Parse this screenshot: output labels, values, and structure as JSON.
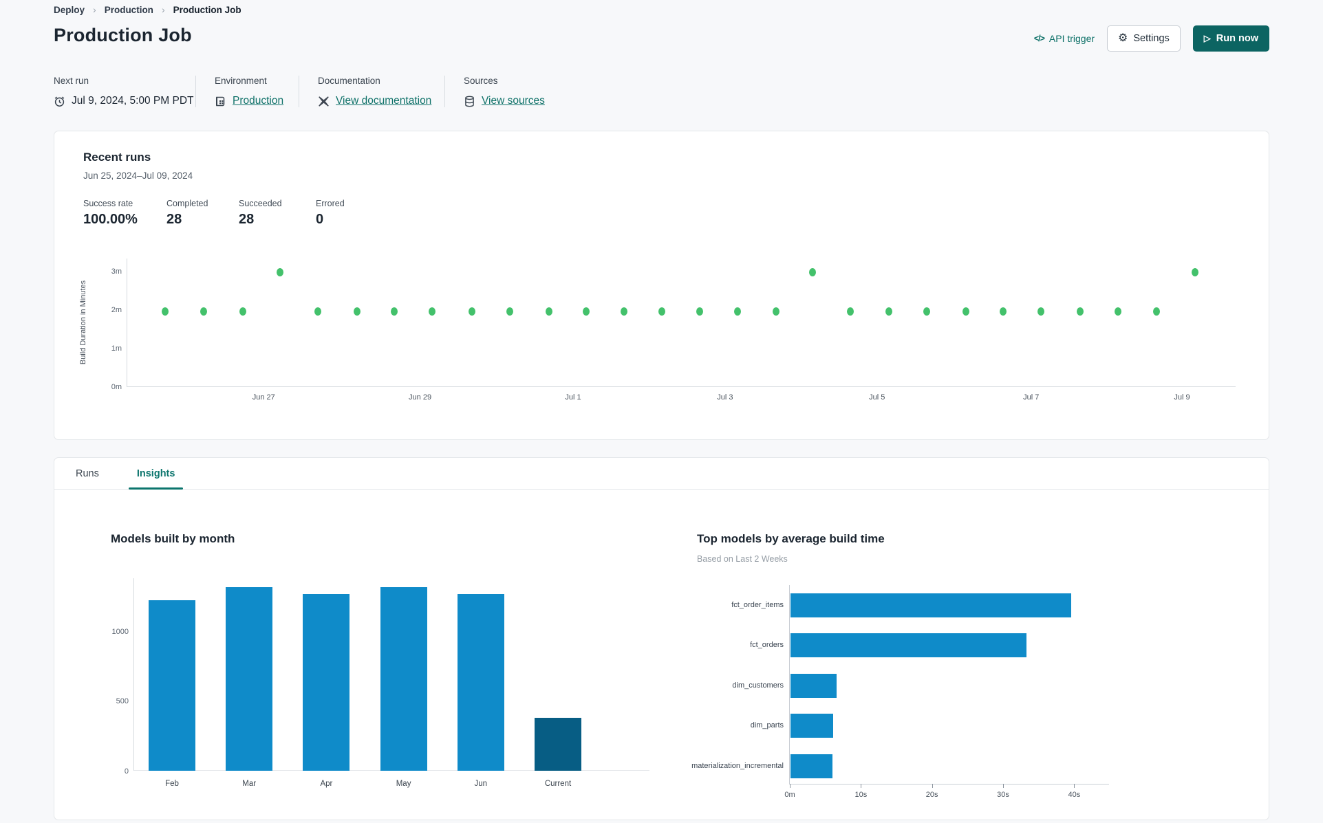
{
  "breadcrumb": {
    "items": [
      "Deploy",
      "Production",
      "Production Job"
    ]
  },
  "header": {
    "title": "Production Job",
    "api_trigger_label": "API trigger",
    "settings_label": "Settings",
    "run_now_label": "Run now"
  },
  "icons": {
    "breadcrumb_sep": "›",
    "code": "</>",
    "gear": "⚙",
    "play": "▷",
    "clock": "alarm-clock",
    "environment": "server-grid",
    "documentation": "dbt-logo",
    "sources": "database-cylinder"
  },
  "info": {
    "next_run": {
      "label": "Next run",
      "value": "Jul 9, 2024, 5:00 PM PDT"
    },
    "environment": {
      "label": "Environment",
      "value": "Production"
    },
    "documentation": {
      "label": "Documentation",
      "value": "View documentation"
    },
    "sources": {
      "label": "Sources",
      "value": "View sources"
    }
  },
  "recent_runs": {
    "title": "Recent runs",
    "date_range": "Jun 25, 2024–Jul 09, 2024",
    "stats": [
      {
        "label": "Success rate",
        "value": "100.00%"
      },
      {
        "label": "Completed",
        "value": "28"
      },
      {
        "label": "Succeeded",
        "value": "28"
      },
      {
        "label": "Errored",
        "value": "0"
      }
    ]
  },
  "tabs": [
    {
      "label": "Runs",
      "active": false
    },
    {
      "label": "Insights",
      "active": true
    }
  ],
  "colors": {
    "accent_teal": "#0c6462",
    "link_teal": "#0e7168",
    "dot_green": "#43c16b",
    "bar_blue": "#0f8bc9",
    "bar_dark": "#075d84"
  },
  "chart_data": [
    {
      "type": "scatter",
      "name": "build-duration-by-run",
      "ylabel": "Build Duration in Minutes",
      "y_ticks": [
        {
          "label": "0m",
          "minutes": 0
        },
        {
          "label": "1m",
          "minutes": 1
        },
        {
          "label": "2m",
          "minutes": 2
        },
        {
          "label": "3m",
          "minutes": 3
        }
      ],
      "ylim_minutes": [
        0,
        3.33
      ],
      "x_ticks": [
        {
          "label": "Jun 27",
          "frac": 0.123
        },
        {
          "label": "Jun 29",
          "frac": 0.264
        },
        {
          "label": "Jul 1",
          "frac": 0.402
        },
        {
          "label": "Jul 3",
          "frac": 0.539
        },
        {
          "label": "Jul 5",
          "frac": 0.676
        },
        {
          "label": "Jul 7",
          "frac": 0.815
        },
        {
          "label": "Jul 9",
          "frac": 0.951
        }
      ],
      "points": [
        {
          "frac": 0.034,
          "minutes": 1.95
        },
        {
          "frac": 0.069,
          "minutes": 1.95
        },
        {
          "frac": 0.104,
          "minutes": 1.95
        },
        {
          "frac": 0.138,
          "minutes": 2.95
        },
        {
          "frac": 0.172,
          "minutes": 1.95
        },
        {
          "frac": 0.207,
          "minutes": 1.95
        },
        {
          "frac": 0.241,
          "minutes": 1.95
        },
        {
          "frac": 0.275,
          "minutes": 1.95
        },
        {
          "frac": 0.311,
          "minutes": 1.95
        },
        {
          "frac": 0.345,
          "minutes": 1.95
        },
        {
          "frac": 0.38,
          "minutes": 1.95
        },
        {
          "frac": 0.414,
          "minutes": 1.95
        },
        {
          "frac": 0.448,
          "minutes": 1.95
        },
        {
          "frac": 0.482,
          "minutes": 1.95
        },
        {
          "frac": 0.516,
          "minutes": 1.95
        },
        {
          "frac": 0.55,
          "minutes": 1.95
        },
        {
          "frac": 0.585,
          "minutes": 1.95
        },
        {
          "frac": 0.618,
          "minutes": 2.95
        },
        {
          "frac": 0.652,
          "minutes": 1.95
        },
        {
          "frac": 0.687,
          "minutes": 1.95
        },
        {
          "frac": 0.721,
          "minutes": 1.95
        },
        {
          "frac": 0.756,
          "minutes": 1.95
        },
        {
          "frac": 0.79,
          "minutes": 1.95
        },
        {
          "frac": 0.824,
          "minutes": 1.95
        },
        {
          "frac": 0.859,
          "minutes": 1.95
        },
        {
          "frac": 0.893,
          "minutes": 1.95
        },
        {
          "frac": 0.928,
          "minutes": 1.95
        },
        {
          "frac": 0.963,
          "minutes": 2.95
        }
      ]
    },
    {
      "type": "bar",
      "title": "Models built by month",
      "categories": [
        "Feb",
        "Mar",
        "Apr",
        "May",
        "Jun",
        "Current"
      ],
      "values": [
        1220,
        1310,
        1265,
        1310,
        1265,
        380
      ],
      "highlight_index": 5,
      "y_ticks": [
        0,
        500,
        1000
      ],
      "ylim": [
        0,
        1376
      ]
    },
    {
      "type": "hbar",
      "title": "Top models by average build time",
      "subtitle": "Based on Last 2 Weeks",
      "categories": [
        "fct_order_items",
        "fct_orders",
        "dim_customers",
        "dim_parts",
        "materialization_incremental"
      ],
      "values_seconds": [
        39.5,
        33.2,
        6.5,
        6.0,
        5.9
      ],
      "x_ticks": [
        {
          "label": "0m",
          "value": 0
        },
        {
          "label": "10s",
          "value": 10
        },
        {
          "label": "20s",
          "value": 20
        },
        {
          "label": "30s",
          "value": 30
        },
        {
          "label": "40s",
          "value": 40
        }
      ],
      "xlim": [
        0,
        45
      ]
    }
  ]
}
